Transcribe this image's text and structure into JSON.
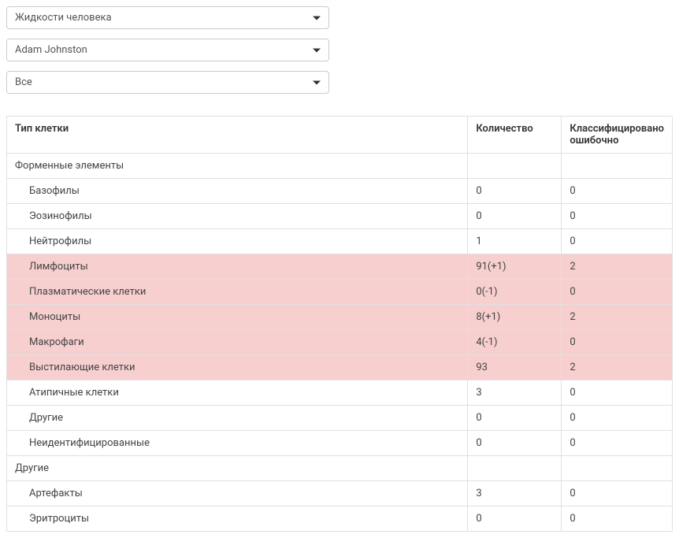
{
  "filters": {
    "type": "Жидкости человека",
    "user": "Adam Johnston",
    "scope": "Все"
  },
  "table": {
    "headers": {
      "cell_type": "Тип клетки",
      "count": "Количество",
      "misclassified": "Классифицировано ошибочно"
    },
    "section1": {
      "title": "Форменные элементы",
      "rows": {
        "r0": {
          "name": "Базофилы",
          "count": "0",
          "mis": "0",
          "hl": false
        },
        "r1": {
          "name": "Эозинофилы",
          "count": "0",
          "mis": "0",
          "hl": false
        },
        "r2": {
          "name": "Нейтрофилы",
          "count": "1",
          "mis": "0",
          "hl": false
        },
        "r3": {
          "name": "Лимфоциты",
          "count": "91(+1)",
          "mis": "2",
          "hl": true
        },
        "r4": {
          "name": "Плазматические клетки",
          "count": "0(-1)",
          "mis": "0",
          "hl": true
        },
        "r5": {
          "name": "Моноциты",
          "count": "8(+1)",
          "mis": "2",
          "hl": true
        },
        "r6": {
          "name": "Макрофаги",
          "count": "4(-1)",
          "mis": "0",
          "hl": true
        },
        "r7": {
          "name": "Выстилающие клетки",
          "count": "93",
          "mis": "2",
          "hl": true
        },
        "r8": {
          "name": "Атипичные клетки",
          "count": "3",
          "mis": "0",
          "hl": false
        },
        "r9": {
          "name": "Другие",
          "count": "0",
          "mis": "0",
          "hl": false
        },
        "r10": {
          "name": "Неидентифицированные",
          "count": "0",
          "mis": "0",
          "hl": false
        }
      }
    },
    "section2": {
      "title": "Другие",
      "rows": {
        "r0": {
          "name": "Артефакты",
          "count": "3",
          "mis": "0",
          "hl": false
        },
        "r1": {
          "name": "Эритроциты",
          "count": "0",
          "mis": "0",
          "hl": false
        }
      }
    }
  }
}
